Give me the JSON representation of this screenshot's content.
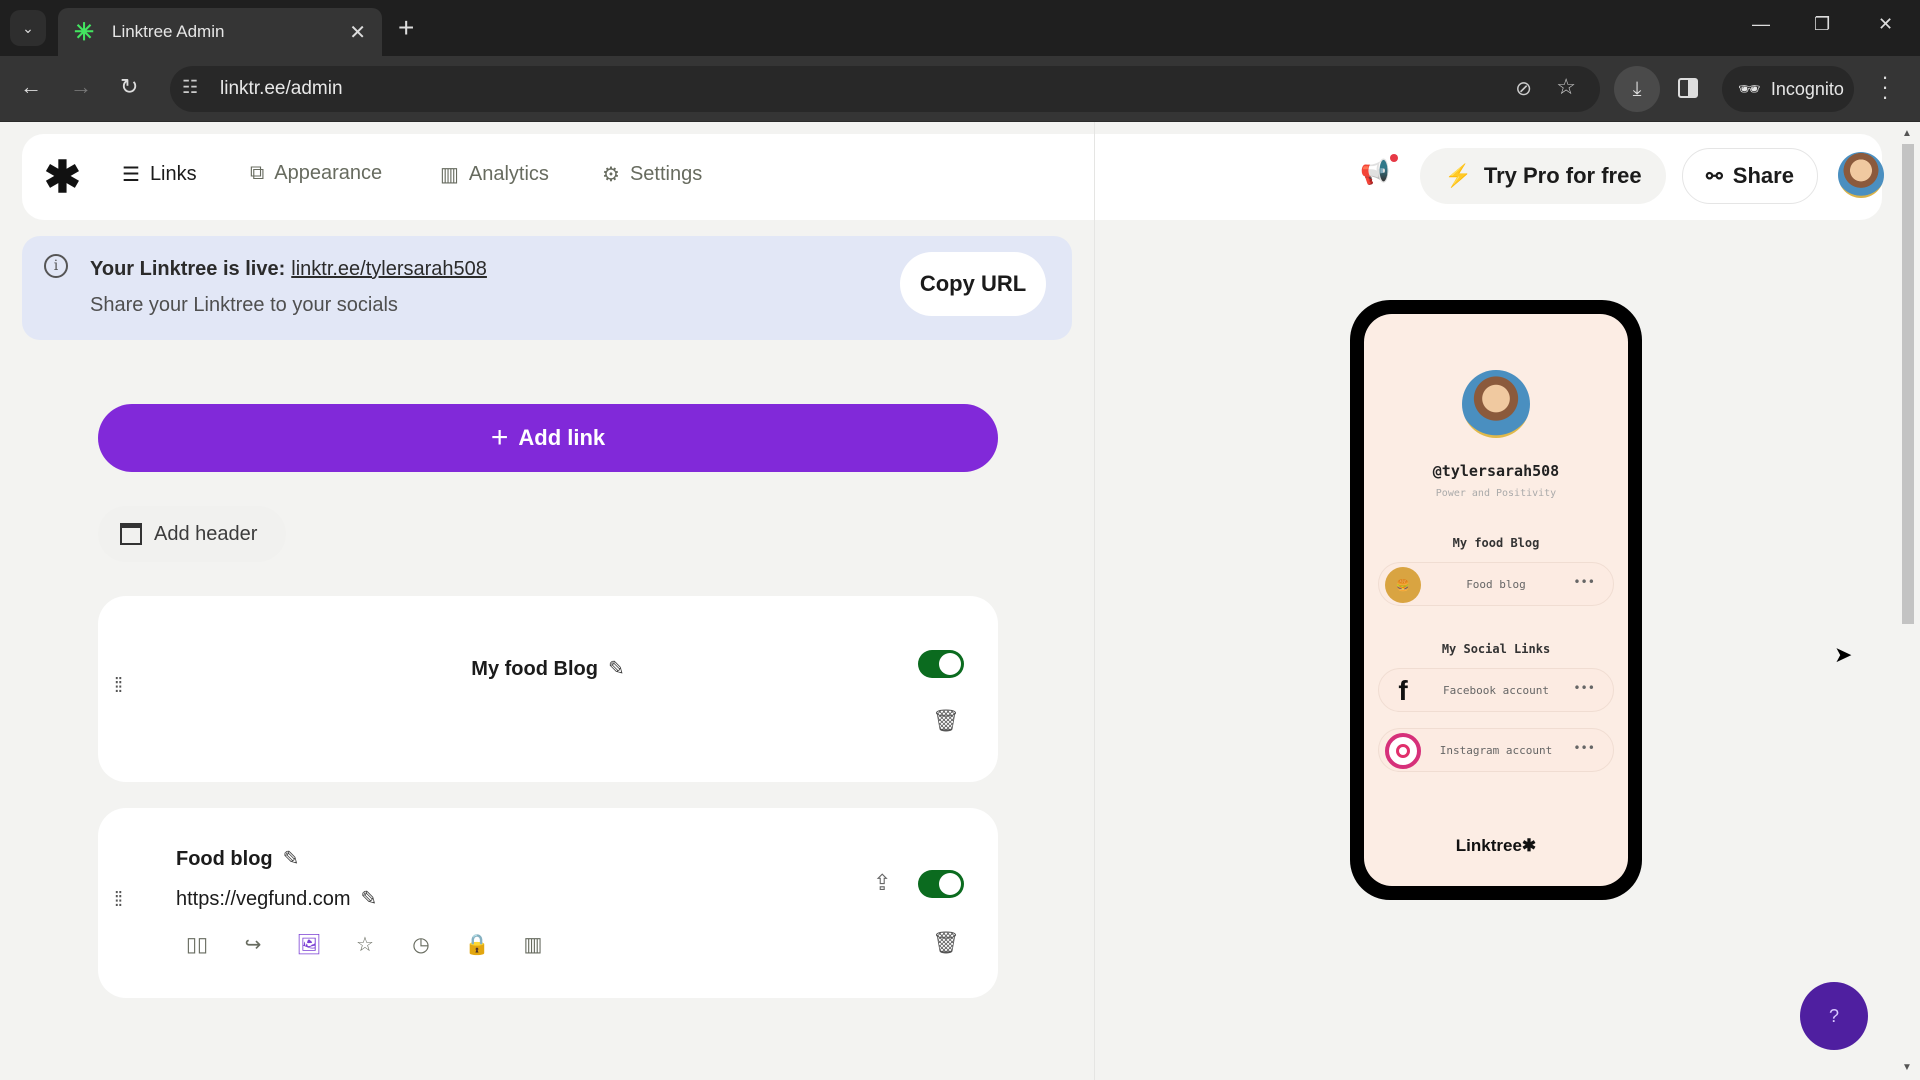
{
  "browser": {
    "tab_title": "Linktree Admin",
    "url": "linktr.ee/admin",
    "incognito_label": "Incognito"
  },
  "nav": {
    "items": [
      {
        "label": "Links",
        "icon": "list-icon",
        "active": true
      },
      {
        "label": "Appearance",
        "icon": "shapes-icon",
        "active": false
      },
      {
        "label": "Analytics",
        "icon": "bar-chart-icon",
        "active": false
      },
      {
        "label": "Settings",
        "icon": "gear-icon",
        "active": false
      }
    ],
    "try_pro_label": "Try Pro for free",
    "share_label": "Share"
  },
  "banner": {
    "live_text": "Your Linktree is live:",
    "live_url": "linktr.ee/tylersarah508",
    "subtext": "Share your Linktree to your socials",
    "copy_url_label": "Copy URL"
  },
  "actions": {
    "add_link_label": "Add link",
    "add_header_label": "Add header"
  },
  "cards": [
    {
      "type": "header",
      "title": "My food Blog",
      "enabled": true
    },
    {
      "type": "link",
      "title": "Food blog",
      "url": "https://vegfund.com",
      "enabled": true,
      "tools": [
        "layout-icon",
        "redirect-icon",
        "thumbnail-icon",
        "star-icon",
        "schedule-icon",
        "lock-icon",
        "analytics-icon"
      ],
      "selected_tool": "thumbnail-icon"
    }
  ],
  "preview": {
    "username": "@tylersarah508",
    "bio": "Power and Positivity",
    "sections": [
      {
        "heading": "My food Blog",
        "links": [
          {
            "label": "Food blog",
            "icon": "burger-thumbnail"
          }
        ]
      },
      {
        "heading": "My Social Links",
        "links": [
          {
            "label": "Facebook account",
            "icon": "facebook-icon"
          },
          {
            "label": "Instagram account",
            "icon": "instagram-icon"
          }
        ]
      }
    ],
    "footer": "Linktree✱",
    "more_glyph": "•••"
  },
  "help_label": "?",
  "colors": {
    "accent": "#8129d9",
    "toggle_on": "#0b6b1f",
    "banner_bg": "#e2e7f6",
    "preview_bg": "#fcede4",
    "help_bg": "#4f1fa0"
  }
}
